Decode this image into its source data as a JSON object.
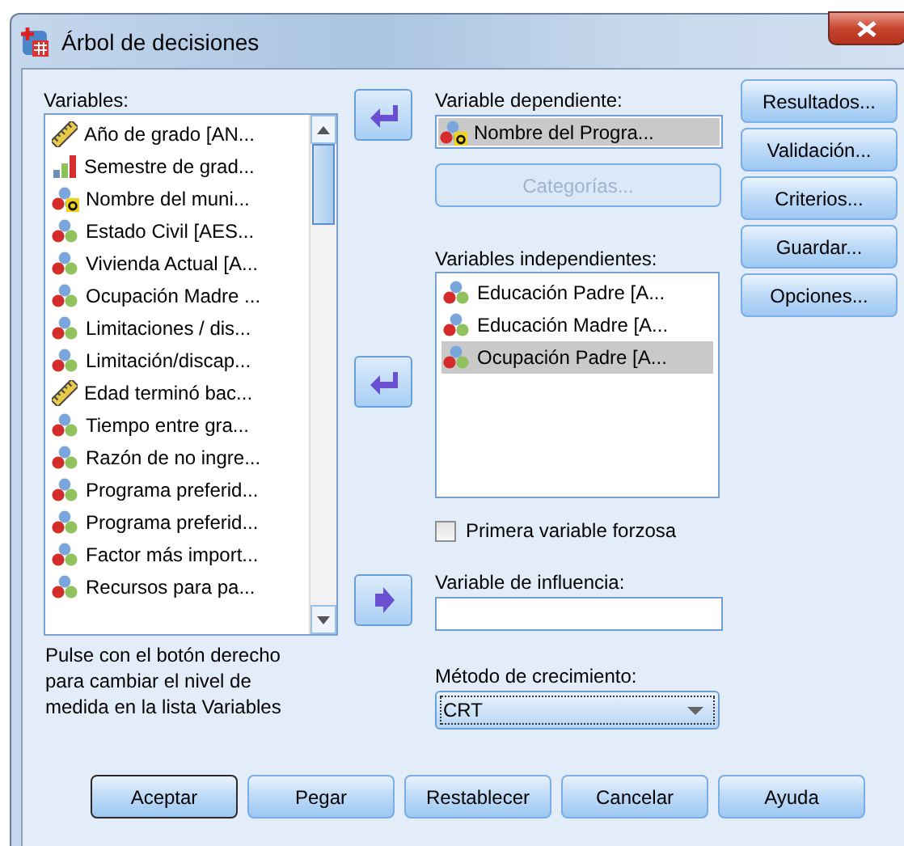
{
  "window": {
    "title": "Árbol de decisiones"
  },
  "variables": {
    "label": "Variables:",
    "items": [
      {
        "name": "Año de grado [AN...",
        "kind": "scale"
      },
      {
        "name": "Semestre de grad...",
        "kind": "ordinal"
      },
      {
        "name": "Nombre del muni...",
        "kind": "string"
      },
      {
        "name": "Estado Civil [AES...",
        "kind": "nominal"
      },
      {
        "name": "Vivienda Actual [A...",
        "kind": "nominal"
      },
      {
        "name": "Ocupación Madre ...",
        "kind": "nominal"
      },
      {
        "name": "Limitaciones / dis...",
        "kind": "nominal"
      },
      {
        "name": "Limitación/discap...",
        "kind": "nominal"
      },
      {
        "name": "Edad terminó bac...",
        "kind": "scale"
      },
      {
        "name": "Tiempo entre gra...",
        "kind": "nominal"
      },
      {
        "name": "Razón de no ingre...",
        "kind": "nominal"
      },
      {
        "name": "Programa preferid...",
        "kind": "nominal"
      },
      {
        "name": "Programa preferid...",
        "kind": "nominal"
      },
      {
        "name": "Factor más import...",
        "kind": "nominal"
      },
      {
        "name": "Recursos para pa...",
        "kind": "nominal"
      }
    ],
    "hint": "Pulse con el botón derecho para cambiar el nivel de medida en la lista Variables"
  },
  "dependent": {
    "label": "Variable dependiente:",
    "value": {
      "name": "Nombre del Progra...",
      "kind": "string"
    }
  },
  "categories_button": {
    "label": "Categorías...",
    "disabled": true
  },
  "independent": {
    "label": "Variables independientes:",
    "items": [
      {
        "name": "Educación Padre [A...",
        "kind": "nominal",
        "selected": false
      },
      {
        "name": "Educación Madre [A...",
        "kind": "nominal",
        "selected": false
      },
      {
        "name": "Ocupación Padre [A...",
        "kind": "nominal",
        "selected": true
      }
    ]
  },
  "force_first": {
    "label": "Primera variable forzosa",
    "checked": false
  },
  "influence": {
    "label": "Variable de influencia:"
  },
  "growth_method": {
    "label": "Método de crecimiento:",
    "value": "CRT"
  },
  "side_buttons": [
    "Resultados...",
    "Validación...",
    "Criterios...",
    "Guardar...",
    "Opciones..."
  ],
  "buttons": [
    {
      "label": "Aceptar",
      "default": true
    },
    {
      "label": "Pegar",
      "default": false
    },
    {
      "label": "Restablecer",
      "default": false
    },
    {
      "label": "Cancelar",
      "default": false
    },
    {
      "label": "Ayuda",
      "default": false
    }
  ]
}
